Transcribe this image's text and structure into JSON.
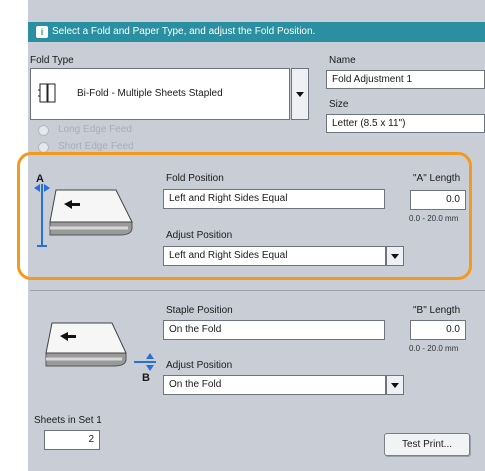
{
  "banner": {
    "text": "Select a Fold and Paper Type, and adjust the Fold Position."
  },
  "fold_type": {
    "label": "Fold Type",
    "value": "Bi-Fold - Multiple Sheets Stapled"
  },
  "name": {
    "label": "Name",
    "value": "Fold Adjustment 1"
  },
  "size": {
    "label": "Size",
    "value": "Letter (8.5 x 11\")"
  },
  "feed": {
    "long_edge": "Long Edge Feed",
    "short_edge": "Short Edge Feed"
  },
  "fold_section": {
    "diagram_label": "A",
    "position_label": "Fold Position",
    "position_value": "Left and Right Sides Equal",
    "length_label": "\"A\" Length",
    "length_value": "0.0",
    "range": "0.0 - 20.0 mm",
    "adjust_label": "Adjust Position",
    "adjust_value": "Left and Right Sides Equal"
  },
  "staple_section": {
    "diagram_label": "B",
    "position_label": "Staple Position",
    "position_value": "On the Fold",
    "length_label": "\"B\" Length",
    "length_value": "0.0",
    "range": "0.0 - 20.0 mm",
    "adjust_label": "Adjust Position",
    "adjust_value": "On the Fold"
  },
  "sheets": {
    "label": "Sheets in Set 1",
    "value": "2"
  },
  "test_print": {
    "label": "Test Print..."
  },
  "colors": {
    "banner": "#2a8fa0",
    "highlight": "#f39a1e",
    "panel": "#c9ced6",
    "accent_blue": "#2a6fd6"
  }
}
